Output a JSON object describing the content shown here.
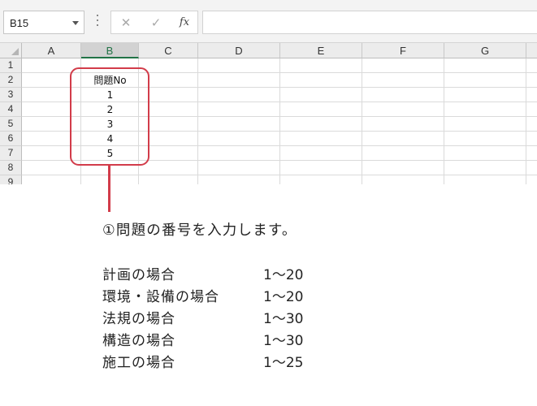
{
  "formula_bar": {
    "name_box": "B15",
    "cancel_icon": "✕",
    "enter_icon": "✓",
    "fx_label": "fx",
    "formula_value": ""
  },
  "sheet": {
    "selected_column": "B",
    "columns": [
      "A",
      "B",
      "C",
      "D",
      "E",
      "F",
      "G"
    ],
    "rows": [
      "1",
      "2",
      "3",
      "4",
      "5",
      "6",
      "7",
      "8",
      "9"
    ],
    "cells": {
      "B2": "問題No",
      "B3": "1",
      "B4": "2",
      "B5": "3",
      "B6": "4",
      "B7": "5"
    }
  },
  "annotation": {
    "accent_color": "#d23c4a",
    "note": "①問題の番号を入力します。",
    "ranges": [
      {
        "label": "計画の場合",
        "value": "1～20"
      },
      {
        "label": "環境・設備の場合",
        "value": "1～20"
      },
      {
        "label": "法規の場合",
        "value": "1～30"
      },
      {
        "label": "構造の場合",
        "value": "1～30"
      },
      {
        "label": "施工の場合",
        "value": "1～25"
      }
    ]
  }
}
